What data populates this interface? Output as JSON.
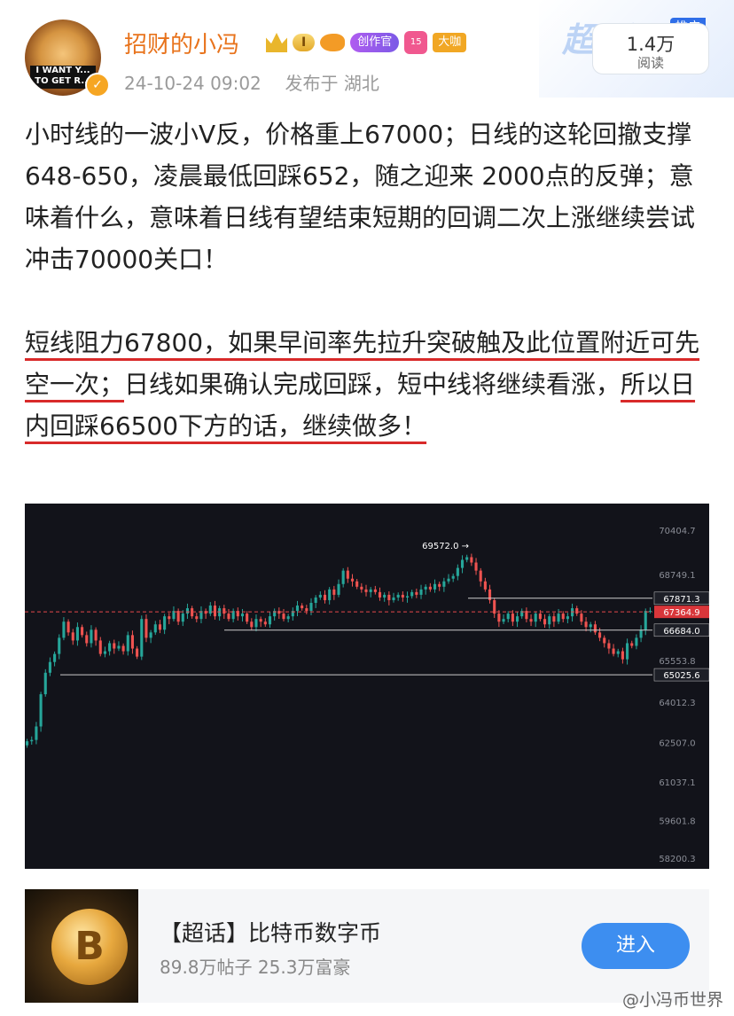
{
  "header": {
    "username": "招财的小冯",
    "level_badge": "I",
    "creator_badge": "创作官",
    "gem_badge": "15",
    "dakan_badge": "大咖",
    "avatar_text": "I WANT Y... TO GET R...",
    "timestamp": "24-10-24 09:02",
    "location": "发布于 湖北",
    "read_count": "1.4万",
    "read_label": "阅读",
    "chaohua_logo": "超话",
    "promo_tag": "推广"
  },
  "post": {
    "paragraph1": "小时线的一波小V反，价格重上67000；日线的这轮回撤支撑648-650，凌晨最低回踩652，随之迎来 2000点的反弹；意味着什么，意味着日线有望结束短期的回调二次上涨继续尝试冲击70000关口！",
    "p2_seg1": "短线阻力67800，如果早间率先拉升突破触及此位置附近可先空一次；",
    "p2_seg2": "日线如果确认完成回踩，短中线将继续看涨，",
    "p2_seg3": "所以日内回踩66500下方的话，继续做多！"
  },
  "chart_data": {
    "type": "candlestick",
    "title": "",
    "ylim": [
      58200.3,
      70404.7
    ],
    "y_ticks": [
      "70404.7",
      "68749.1",
      "65553.8",
      "64012.3",
      "62507.0",
      "61037.1",
      "59601.8",
      "58200.3"
    ],
    "annotations": [
      {
        "label": "69572.0",
        "value": 69572.0
      }
    ],
    "levels": [
      {
        "value": 67871.3,
        "label": "67871.3",
        "style": "solid",
        "color": "#cccccc"
      },
      {
        "value": 67364.9,
        "label": "67364.9",
        "style": "dashed",
        "color": "#e5474b"
      },
      {
        "value": 66684.0,
        "label": "66684.0",
        "style": "solid",
        "color": "#cccccc"
      },
      {
        "value": 65025.6,
        "label": "65025.6",
        "style": "solid",
        "color": "#cccccc"
      }
    ],
    "close": [
      62550,
      62600,
      63100,
      64300,
      65100,
      65500,
      65800,
      66400,
      67000,
      66600,
      66300,
      66800,
      66500,
      66200,
      66700,
      66300,
      65800,
      65900,
      66200,
      66000,
      66100,
      65900,
      66500,
      66000,
      65700,
      67100,
      66400,
      66600,
      66900,
      66700,
      67200,
      67100,
      67400,
      67000,
      67300,
      67500,
      67200,
      67100,
      67400,
      67300,
      67600,
      67200,
      67500,
      67300,
      67100,
      67400,
      67200,
      67300,
      67000,
      66800,
      67100,
      67000,
      66900,
      67200,
      67400,
      67300,
      67100,
      67200,
      67400,
      67600,
      67500,
      67400,
      67700,
      67900,
      68000,
      67800,
      68200,
      68000,
      68400,
      68900,
      68600,
      68500,
      68300,
      68200,
      68100,
      68200,
      68100,
      67900,
      68000,
      67800,
      67900,
      68000,
      67900,
      67950,
      68100,
      68000,
      68200,
      68300,
      68200,
      68400,
      68300,
      68500,
      68600,
      68700,
      69000,
      69300,
      69400,
      69200,
      68900,
      68500,
      68200,
      67800,
      67300,
      67000,
      67100,
      67300,
      67000,
      67200,
      67400,
      67100,
      67000,
      67300,
      67100,
      66900,
      67200,
      67000,
      67300,
      67100,
      67200,
      67500,
      67300,
      67000,
      66800,
      66900,
      66600,
      66400,
      66200,
      66000,
      65800,
      65900,
      65600,
      66200,
      66100,
      66400,
      66700,
      67400,
      67400
    ]
  },
  "card": {
    "title": "【超话】比特币数字币",
    "stats": "89.8万帖子 25.3万富豪",
    "join_label": "进入",
    "coin_symbol": "B"
  },
  "watermark": "@小冯币世界",
  "colors": {
    "up": "#26a69a",
    "down": "#ef5350",
    "accent": "#e8731c",
    "underline": "#d82a2a"
  }
}
